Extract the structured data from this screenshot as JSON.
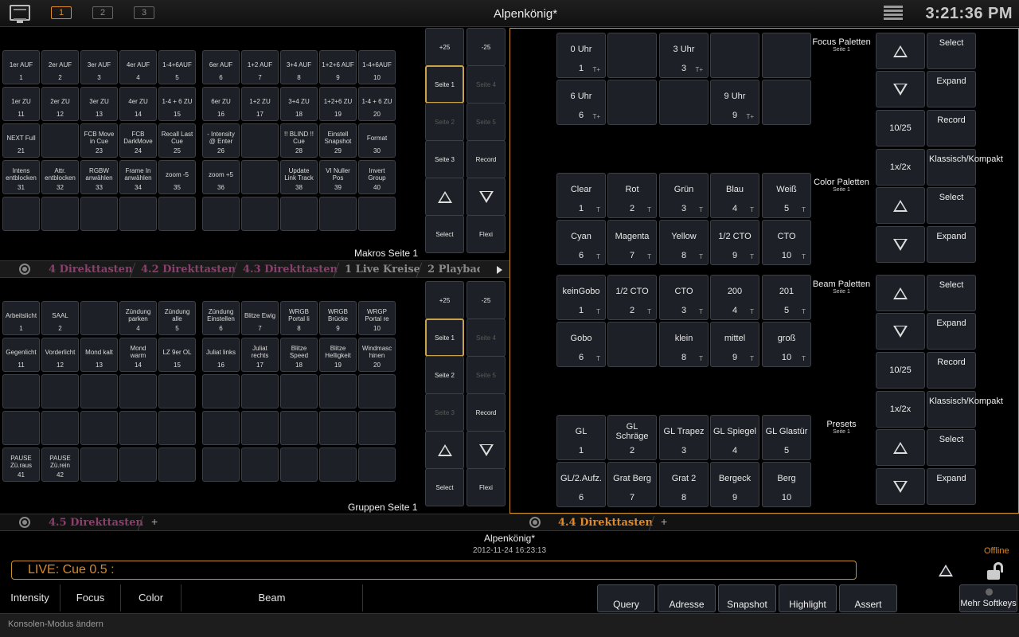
{
  "topbar": {
    "title": "Alpenkönig*",
    "clock": "3:21:36 PM",
    "desks": [
      "1",
      "2",
      "3"
    ]
  },
  "macros": {
    "title": "Makros Seite 1",
    "tiles": [
      [
        "1er AUF",
        "1"
      ],
      [
        "2er AUF",
        "2"
      ],
      [
        "3er AUF",
        "3"
      ],
      [
        "4er AUF",
        "4"
      ],
      [
        "1-4+6AUF",
        "5"
      ],
      [
        "6er AUF",
        "6"
      ],
      [
        "1+2 AUF",
        "7"
      ],
      [
        "3+4 AUF",
        "8"
      ],
      [
        "1+2+6 AUF",
        "9"
      ],
      [
        "1-4+6AUF",
        "10"
      ],
      [
        "1er ZU",
        "11"
      ],
      [
        "2er ZU",
        "12"
      ],
      [
        "3er ZU",
        "13"
      ],
      [
        "4er ZU",
        "14"
      ],
      [
        "1-4 + 6 ZU",
        "15"
      ],
      [
        "6er ZU",
        "16"
      ],
      [
        "1+2 ZU",
        "17"
      ],
      [
        "3+4 ZU",
        "18"
      ],
      [
        "1+2+6 ZU",
        "19"
      ],
      [
        "1-4 + 6 ZU",
        "20"
      ],
      [
        "NEXT Full",
        "21"
      ],
      [
        "",
        ""
      ],
      [
        "FCB Move in Cue",
        "23"
      ],
      [
        "FCB DarkMove",
        "24"
      ],
      [
        "Recall Last Cue",
        "25"
      ],
      [
        "- Intensity @ Enter",
        "26"
      ],
      [
        "",
        ""
      ],
      [
        "!! BLIND !! Cue",
        "28"
      ],
      [
        "Einstell Snapshot",
        "29"
      ],
      [
        "Format",
        "30"
      ],
      [
        "Intens entblocken",
        "31"
      ],
      [
        "Attr. entblocken",
        "32"
      ],
      [
        "RGBW anwählen",
        "33"
      ],
      [
        "Frame In anwählen",
        "34"
      ],
      [
        "zoom -5",
        "35"
      ],
      [
        "zoom +5",
        "36"
      ],
      [
        "",
        ""
      ],
      [
        "Update Link Track",
        "38"
      ],
      [
        "VI Nuller Pos",
        "39"
      ],
      [
        "Invert Group",
        "40"
      ],
      [
        "",
        ""
      ],
      [
        "",
        ""
      ],
      [
        "",
        ""
      ],
      [
        "",
        ""
      ],
      [
        "",
        ""
      ],
      [
        "",
        ""
      ],
      [
        "",
        ""
      ],
      [
        "",
        ""
      ],
      [
        "",
        ""
      ],
      [
        "",
        ""
      ]
    ]
  },
  "groups": {
    "title": "Gruppen Seite 1",
    "tiles": [
      [
        "Arbeitslicht",
        "1"
      ],
      [
        "SAAL",
        "2"
      ],
      [
        "",
        ""
      ],
      [
        "Zündung parken",
        "4"
      ],
      [
        "Zündung alle",
        "5"
      ],
      [
        "Zündung Einstellen",
        "6"
      ],
      [
        "Blitze Ewig",
        "7"
      ],
      [
        "WRGB Portal li",
        "8"
      ],
      [
        "WRGB Brücke",
        "9"
      ],
      [
        "WRGP Portal re",
        "10"
      ],
      [
        "Gegenlicht",
        "11"
      ],
      [
        "Vorderlicht",
        "12"
      ],
      [
        "Mond kalt",
        "13"
      ],
      [
        "Mond warm",
        "14"
      ],
      [
        "LZ 9er OL",
        "15"
      ],
      [
        "Juliat links",
        "16"
      ],
      [
        "Juliat rechts",
        "17"
      ],
      [
        "Blitze Speed",
        "18"
      ],
      [
        "Blitze Helligkeit",
        "19"
      ],
      [
        "Windmasc hinen",
        "20"
      ],
      [
        "",
        ""
      ],
      [
        "",
        ""
      ],
      [
        "",
        ""
      ],
      [
        "",
        ""
      ],
      [
        "",
        ""
      ],
      [
        "",
        ""
      ],
      [
        "",
        ""
      ],
      [
        "",
        ""
      ],
      [
        "",
        ""
      ],
      [
        "",
        ""
      ],
      [
        "",
        ""
      ],
      [
        "",
        ""
      ],
      [
        "",
        ""
      ],
      [
        "",
        ""
      ],
      [
        "",
        ""
      ],
      [
        "",
        ""
      ],
      [
        "",
        ""
      ],
      [
        "",
        ""
      ],
      [
        "",
        ""
      ],
      [
        "",
        ""
      ],
      [
        "PAUSE Zü.raus",
        "41"
      ],
      [
        "PAUSE Zü.rein",
        "42"
      ],
      [
        "",
        ""
      ],
      [
        "",
        ""
      ],
      [
        "",
        ""
      ],
      [
        "",
        ""
      ],
      [
        "",
        ""
      ],
      [
        "",
        ""
      ],
      [
        "",
        ""
      ],
      [
        "",
        ""
      ]
    ]
  },
  "pager_top": {
    "plus": "+25",
    "minus": "-25",
    "seite1": "Seite 1",
    "seite4": "Seite 4",
    "seite2": "Seite 2",
    "seite5": "Seite 5",
    "seite3": "Seite 3",
    "record": "Record",
    "select": "Select",
    "flexi": "Flexi"
  },
  "pager_bottom": {
    "plus": "+25",
    "minus": "-25",
    "seite1": "Seite 1",
    "seite4": "Seite 4",
    "seite2": "Seite 2",
    "seite5": "Seite 5",
    "seite3": "Seite 3",
    "record": "Record",
    "select": "Select",
    "flexi": "Flexi"
  },
  "tabs_top": [
    "4 Direkttasten",
    "4.2 Direkttasten",
    "4.3 Direkttasten",
    "1 Live Kreise",
    "2 Playbac"
  ],
  "tabs_bottom_left": [
    "4.5 Direkttasten"
  ],
  "tabs_bottom_right": [
    "4.4 Direkttasten"
  ],
  "palettes": {
    "focus": {
      "head": "Focus Paletten",
      "sub": "Seite 1",
      "tiles": [
        [
          "0 Uhr",
          "1",
          "T+"
        ],
        [
          "",
          "",
          ""
        ],
        [
          "3 Uhr",
          "3",
          "T+"
        ],
        [
          "",
          "",
          ""
        ],
        [
          "",
          "",
          ""
        ],
        [
          "6 Uhr",
          "6",
          "T+"
        ],
        [
          "",
          "",
          ""
        ],
        [
          "",
          "",
          ""
        ],
        [
          "9 Uhr",
          "9",
          "T+"
        ],
        [
          "",
          "",
          ""
        ]
      ]
    },
    "color": {
      "head": "Color Paletten",
      "sub": "Seite 1",
      "tiles": [
        [
          "Clear",
          "1",
          "T"
        ],
        [
          "Rot",
          "2",
          "T"
        ],
        [
          "Grün",
          "3",
          "T"
        ],
        [
          "Blau",
          "4",
          "T"
        ],
        [
          "Weiß",
          "5",
          "T"
        ],
        [
          "Cyan",
          "6",
          "T"
        ],
        [
          "Magenta",
          "7",
          "T"
        ],
        [
          "Yellow",
          "8",
          "T"
        ],
        [
          "1/2 CTO",
          "9",
          "T"
        ],
        [
          "CTO",
          "10",
          "T"
        ]
      ]
    },
    "beam": {
      "head": "Beam Paletten",
      "sub": "Seite 1",
      "tiles": [
        [
          "keinGobo",
          "1",
          "T"
        ],
        [
          "1/2 CTO",
          "2",
          "T"
        ],
        [
          "CTO",
          "3",
          "T"
        ],
        [
          "200",
          "4",
          "T"
        ],
        [
          "201",
          "5",
          "T"
        ],
        [
          "Gobo",
          "6",
          "T"
        ],
        [
          "",
          "",
          ""
        ],
        [
          "klein",
          "8",
          "T"
        ],
        [
          "mittel",
          "9",
          "T"
        ],
        [
          "groß",
          "10",
          "T"
        ]
      ]
    },
    "presets": {
      "head": "Presets",
      "sub": "Seite 1",
      "tiles": [
        [
          "GL",
          "1",
          ""
        ],
        [
          "GL Schräge",
          "2",
          ""
        ],
        [
          "GL Trapez",
          "3",
          ""
        ],
        [
          "GL Spiegel",
          "4",
          ""
        ],
        [
          "GL Glastür",
          "5",
          ""
        ],
        [
          "GL/2.Aufz.",
          "6",
          ""
        ],
        [
          "Grat Berg",
          "7",
          ""
        ],
        [
          "Grat 2",
          "8",
          ""
        ],
        [
          "Bergeck",
          "9",
          ""
        ],
        [
          "Berg",
          "10",
          ""
        ]
      ]
    }
  },
  "right_buttons": {
    "select": "Select",
    "expand": "Expand",
    "record": "Record",
    "ratio": "10/25",
    "zoom": "1x/2x",
    "mode": "Klassisch/Kompakt"
  },
  "show_info": {
    "name": "Alpenkönig*",
    "date": "2012-11-24 16:23:13"
  },
  "status": {
    "offline": "Offline"
  },
  "cmdline": "LIVE: Cue  0.5 :",
  "bottom_tabs": [
    "Intensity",
    "Focus",
    "Color",
    "Beam"
  ],
  "softkeys": [
    "Query",
    "Adresse",
    "Snapshot",
    "Highlight",
    "Assert"
  ],
  "more_softkeys": "Mehr Softkeys",
  "statusbar": "Konsolen-Modus ändern"
}
